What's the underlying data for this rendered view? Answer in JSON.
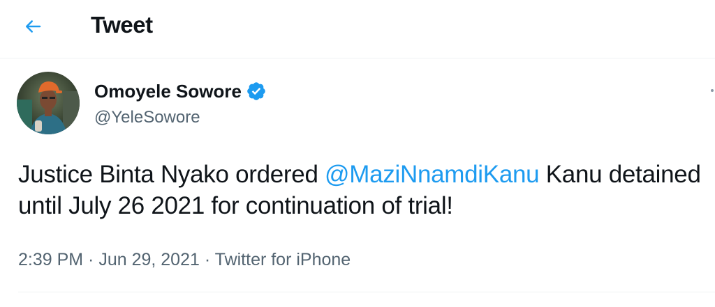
{
  "header": {
    "back_icon": "arrow-left-icon",
    "title": "Tweet",
    "accent_color": "#1d9bf0"
  },
  "author": {
    "name": "Omoyele Sowore",
    "verified_icon": "verified-badge-icon",
    "handle": "@YeleSowore",
    "avatar_icon": "profile-photo"
  },
  "tweet": {
    "text_before": "Justice Binta Nyako ordered ",
    "mention": "@MaziNnamdiKanu",
    "text_after": " Kanu detained until July 26 2021 for continuation of trial!"
  },
  "meta": {
    "time": "2:39 PM",
    "separator": " · ",
    "date": "Jun 29, 2021",
    "source": "Twitter for iPhone"
  },
  "colors": {
    "text": "#0f1419",
    "secondary": "#536471",
    "link": "#1d9bf0",
    "divider": "#eff3f4"
  }
}
